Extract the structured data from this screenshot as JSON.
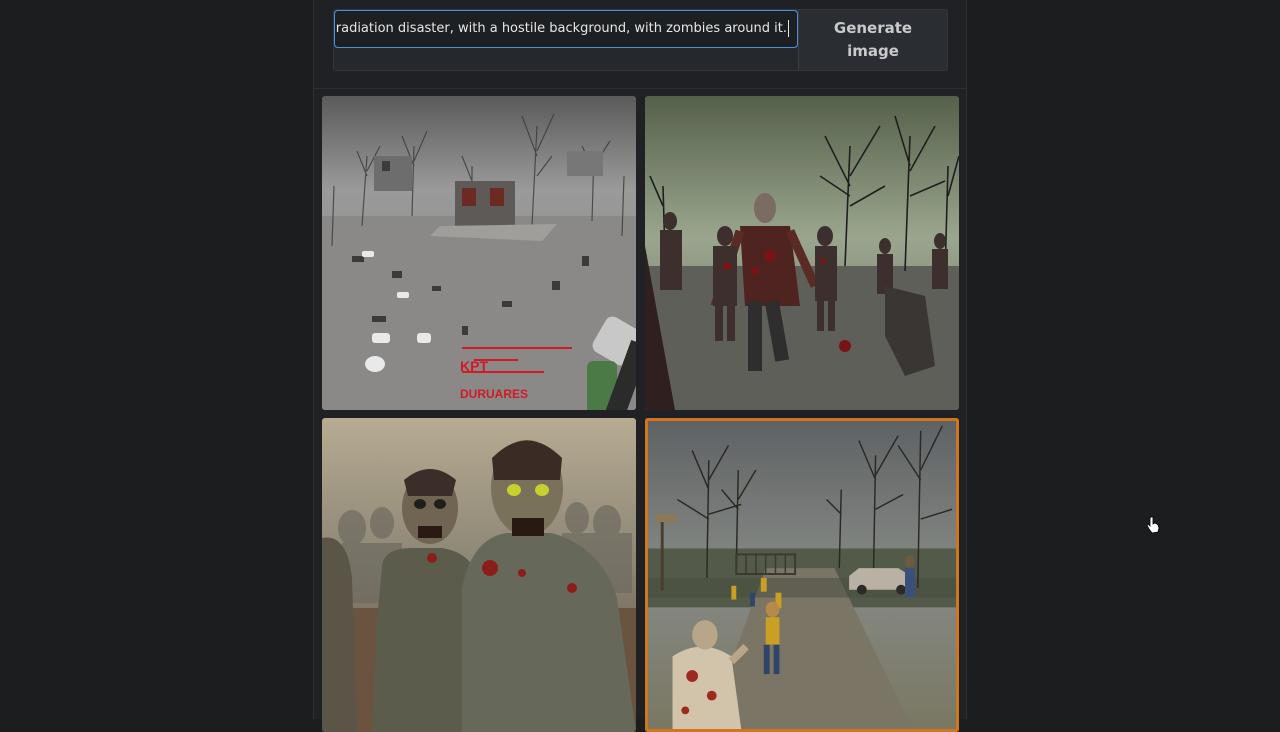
{
  "prompt": {
    "value": "a radiation disaster, with a hostile background, with zombies around it.",
    "overflow_marker": "'"
  },
  "generate_button": {
    "label_line1": "Generate",
    "label_line2": "image"
  },
  "images": [
    {
      "alt": "Wasteland with ruined buildings and a gun in the foreground",
      "overlay_text_1": "KPT",
      "overlay_text_2": "DURUARES",
      "selected": false
    },
    {
      "alt": "Horde of bloody zombies in a misty forest",
      "selected": false
    },
    {
      "alt": "Two decayed zombies close-up in a desolate field",
      "selected": false
    },
    {
      "alt": "Illustrated road with zombies, bare trees and a wrecked car",
      "selected": true
    }
  ],
  "colors": {
    "accent_focus": "#4d8fcf",
    "selected_border": "#d0761e",
    "overlay_red": "#d01a25"
  }
}
